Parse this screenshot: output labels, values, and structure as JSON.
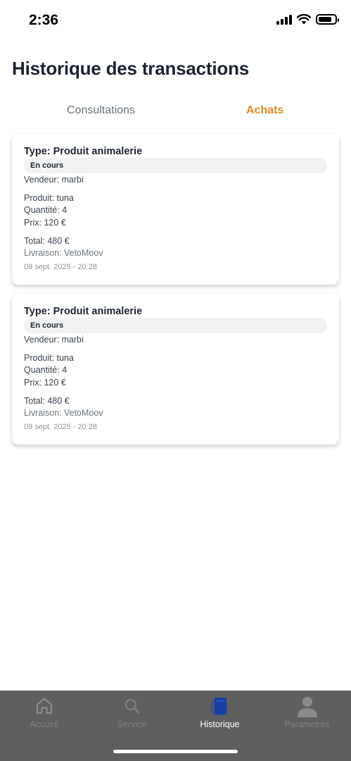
{
  "status_bar": {
    "time": "2:36"
  },
  "page": {
    "title": "Historique des transactions"
  },
  "tabs": [
    {
      "label": "Consultations",
      "active": false
    },
    {
      "label": "Achats",
      "active": true
    }
  ],
  "transactions": [
    {
      "type": "Type: Produit animalerie",
      "status": "En cours",
      "vendor": "Vendeur: marbi",
      "product": "Produit: tuna",
      "quantity": "Quantité: 4",
      "price": "Prix: 120 €",
      "total": "Total: 480 €",
      "delivery": "Livraison: VetoMoov",
      "date": "09 sept. 2025 - 20:28"
    },
    {
      "type": "Type: Produit animalerie",
      "status": "En cours",
      "vendor": "Vendeur: marbi",
      "product": "Produit: tuna",
      "quantity": "Quantité: 4",
      "price": "Prix: 120 €",
      "total": "Total: 480 €",
      "delivery": "Livraison: VetoMoov",
      "date": "09 sept. 2025 - 20:28"
    }
  ],
  "bottom_nav": [
    {
      "label": "Accueil",
      "icon": "home-icon",
      "active": false
    },
    {
      "label": "Service",
      "icon": "search-icon",
      "active": false
    },
    {
      "label": "Historique",
      "icon": "receipt-icon",
      "active": true
    },
    {
      "label": "Parametres",
      "icon": "user-icon",
      "active": false
    }
  ],
  "colors": {
    "accent": "#e08a1a",
    "nav_active_icon": "#1a3ea8",
    "nav_background": "#5f5f5f",
    "badge_background": "#f1f2f4"
  }
}
